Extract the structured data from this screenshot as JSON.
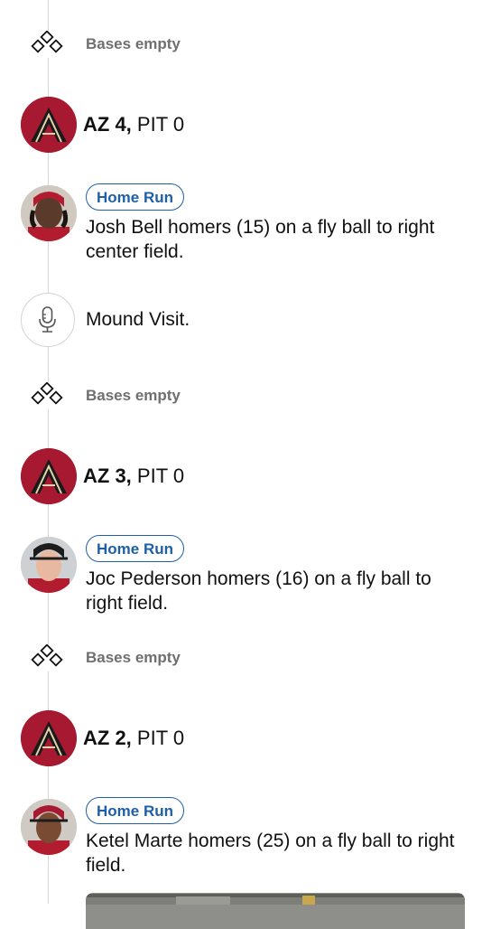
{
  "feed": {
    "bases_empty": "Bases empty",
    "events": [
      {
        "type": "bases",
        "label": "Bases empty"
      },
      {
        "type": "score",
        "team_a": "AZ 4,",
        "team_b": "PIT 0"
      },
      {
        "type": "play",
        "badge": "Home Run",
        "text": "Josh Bell homers (15) on a fly ball to right center field."
      },
      {
        "type": "mound",
        "text": "Mound Visit."
      },
      {
        "type": "bases",
        "label": "Bases empty"
      },
      {
        "type": "score",
        "team_a": "AZ 3,",
        "team_b": "PIT 0"
      },
      {
        "type": "play",
        "badge": "Home Run",
        "text": "Joc Pederson homers (16) on a fly ball to right field."
      },
      {
        "type": "bases",
        "label": "Bases empty"
      },
      {
        "type": "score",
        "team_a": "AZ 2,",
        "team_b": "PIT 0"
      },
      {
        "type": "play",
        "badge": "Home Run",
        "text": "Ketel Marte homers (25) on a fly ball to right field."
      }
    ]
  },
  "colors": {
    "badge_blue": "#1f5fa8",
    "team_red": "#a71930",
    "muted_text": "#6f6f6f",
    "timeline": "#d8d8d8"
  },
  "icons": {
    "bases": "bases-diamond-icon",
    "team": "dbacks-logo-icon",
    "mic": "microphone-icon"
  }
}
